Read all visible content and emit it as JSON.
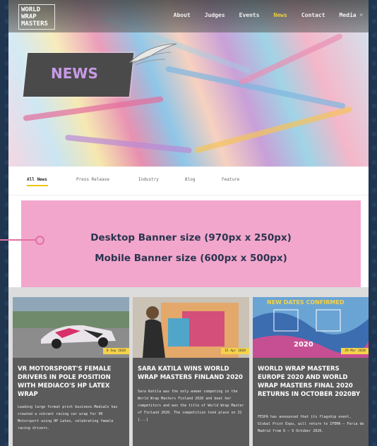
{
  "site": {
    "logo_lines": "WORLD\nWRAP\nMASTERS",
    "nav": [
      {
        "label": "About"
      },
      {
        "label": "Judges"
      },
      {
        "label": "Events"
      },
      {
        "label": "News",
        "active": true
      },
      {
        "label": "Contact"
      },
      {
        "label": "Media ˅"
      }
    ]
  },
  "hero": {
    "title": "NEWS"
  },
  "tabs": [
    {
      "label": "All News",
      "active": true
    },
    {
      "label": "Press Release"
    },
    {
      "label": "Industry"
    },
    {
      "label": "Blog"
    },
    {
      "label": "Feature"
    }
  ],
  "ad": {
    "line1": "Desktop Banner size (970px x 250px)",
    "line2": "Mobile Banner size (600px x 500px)",
    "color": "#f2a6cc"
  },
  "cards": [
    {
      "date": "8 Sep 2020",
      "title": "VR MOTORSPORT'S FEMALE DRIVERS IN POLE POSITION WITH MEDIACO'S HP LATEX WRAP",
      "excerpt": "Leading large format print business MediaCo has created a vibrant racing car wrap for VR Motorsport using HP Latex, celebrating female racing drivers."
    },
    {
      "date": "15 Apr 2020",
      "title": "SARA KATILA WINS WORLD WRAP MASTERS FINLAND 2020",
      "excerpt": "Sara Katila was the only woman competing in the World Wrap Masters Finland 2020 and beat her competitors and won the title of World Wrap Master of Finland 2020. The competition took place on 31 [...]"
    },
    {
      "date": "29 Mar 2020",
      "title": "WORLD WRAP MASTERS EUROPE 2020 AND WORLD WRAP MASTERS FINAL 2020 RETURNS IN OCTOBER 2020BY",
      "excerpt": "FESPA has announced that its flagship event, Global Print Expo, will return to IFEMA – Feria de Madrid from 6 – 9 October 2020.",
      "image_text": "NEW DATES CONFIRMED",
      "image_year": "2020"
    }
  ]
}
